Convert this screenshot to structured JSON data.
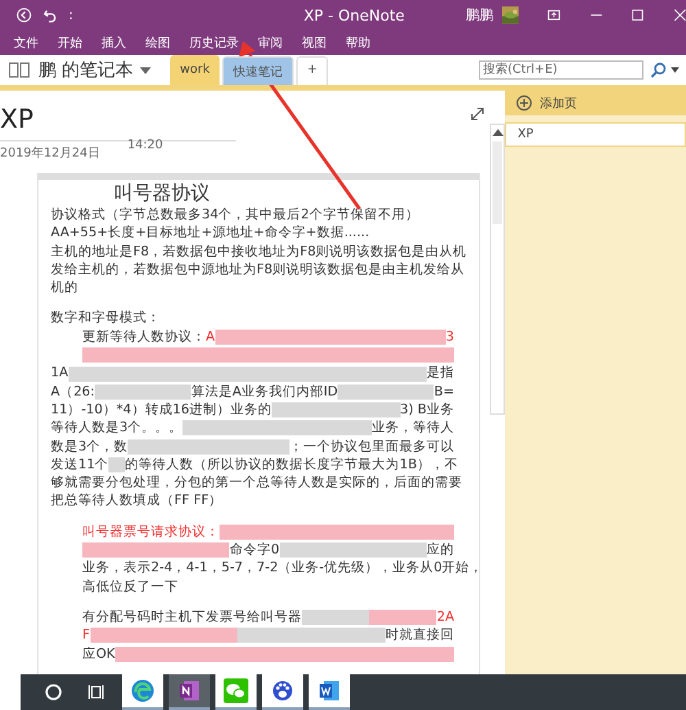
{
  "window": {
    "title": "XP - OneNote",
    "quick_access": ":",
    "user": "鹏鹏"
  },
  "menu": [
    {
      "label": "文件"
    },
    {
      "label": "开始"
    },
    {
      "label": "插入"
    },
    {
      "label": "绘图"
    },
    {
      "label": "历史记录"
    },
    {
      "label": "审阅"
    },
    {
      "label": "视图"
    },
    {
      "label": "帮助"
    }
  ],
  "notebook": {
    "name": "鹏 的笔记本"
  },
  "sections": [
    {
      "label": "work",
      "selected": true,
      "color": "#f3d374"
    },
    {
      "label": "快速笔记",
      "selected": false,
      "color": "#9fc4e8"
    },
    {
      "label": "+",
      "selected": false,
      "color": "#ffffff"
    }
  ],
  "search": {
    "placeholder": "搜索(Ctrl+E)"
  },
  "page": {
    "title": "XP",
    "date": "2019年12月24日",
    "time": "14:20"
  },
  "note": {
    "heading": "叫号器协议",
    "lines": [
      {
        "kind": "line",
        "indent": false,
        "segments": [
          {
            "kind": "text",
            "text": "协议格式（字节总数最多34个，其中最后2个字节保留不用）"
          }
        ]
      },
      {
        "kind": "line",
        "indent": false,
        "segments": [
          {
            "kind": "text",
            "text": "AA+55+长度+目标地址+源地址+命令字+数据......"
          }
        ]
      },
      {
        "kind": "line",
        "indent": false,
        "segments": [
          {
            "kind": "text",
            "text": "主机的地址是F8，若数据包中接收地址为F8则说明该数据包是由从机"
          }
        ]
      },
      {
        "kind": "line",
        "indent": false,
        "segments": [
          {
            "kind": "text",
            "text": "发给主机的，若数据包中源地址为F8则说明该数据包是由主机发给从"
          }
        ]
      },
      {
        "kind": "line",
        "indent": false,
        "segments": [
          {
            "kind": "text",
            "text": "机的"
          }
        ]
      },
      {
        "kind": "blank"
      },
      {
        "kind": "line",
        "indent": false,
        "segments": [
          {
            "kind": "text",
            "text": "数字和字母模式："
          }
        ]
      },
      {
        "kind": "line",
        "indent": true,
        "segments": [
          {
            "kind": "text",
            "text": "更新等待人数协议："
          },
          {
            "kind": "red",
            "text": "A"
          },
          {
            "kind": "blur_red"
          },
          {
            "kind": "red",
            "text": "3"
          }
        ]
      },
      {
        "kind": "line",
        "indent": true,
        "segments": [
          {
            "kind": "blur_red"
          }
        ]
      },
      {
        "kind": "line",
        "indent": false,
        "segments": [
          {
            "kind": "text",
            "text": "1A"
          },
          {
            "kind": "blur"
          },
          {
            "kind": "text",
            "text": "是指"
          }
        ]
      },
      {
        "kind": "line",
        "indent": false,
        "segments": [
          {
            "kind": "text",
            "text": "A（26:"
          },
          {
            "kind": "blur"
          },
          {
            "kind": "text",
            "text": "算法是A业务我们内部ID"
          },
          {
            "kind": "blur"
          },
          {
            "kind": "text",
            "text": "B="
          }
        ]
      },
      {
        "kind": "line",
        "indent": false,
        "segments": [
          {
            "kind": "text",
            "text": "11）-10）*4）转成16进制）业务的"
          },
          {
            "kind": "blur"
          },
          {
            "kind": "text",
            "text": "3) B业务"
          }
        ]
      },
      {
        "kind": "line",
        "indent": false,
        "segments": [
          {
            "kind": "text",
            "text": "等待人数是3个。。。"
          },
          {
            "kind": "blur"
          },
          {
            "kind": "text",
            "text": "业务，等待人"
          }
        ]
      },
      {
        "kind": "line",
        "indent": false,
        "segments": [
          {
            "kind": "text",
            "text": "数是3个，数"
          },
          {
            "kind": "blur"
          },
          {
            "kind": "text",
            "text": "；一个协议包里面最多可以"
          }
        ]
      },
      {
        "kind": "line",
        "indent": false,
        "segments": [
          {
            "kind": "text",
            "text": "发送11个"
          },
          {
            "kind": "blur"
          },
          {
            "kind": "text",
            "text": "的等待人数（所以协议的数据长度字节最大为1B），不"
          }
        ]
      },
      {
        "kind": "line",
        "indent": false,
        "segments": [
          {
            "kind": "text",
            "text": "够就需要分包处理，分包的第一个总等待人数是实际的，后面的需要"
          }
        ]
      },
      {
        "kind": "line",
        "indent": false,
        "segments": [
          {
            "kind": "text",
            "text": "把总等待人数填成（FF FF）"
          }
        ]
      },
      {
        "kind": "blank"
      },
      {
        "kind": "line",
        "indent": true,
        "segments": [
          {
            "kind": "red",
            "text": "叫号器票号请求协议："
          },
          {
            "kind": "blur_red"
          }
        ]
      },
      {
        "kind": "line",
        "indent": true,
        "segments": [
          {
            "kind": "blur_red"
          },
          {
            "kind": "text",
            "text": "命令字0"
          },
          {
            "kind": "blur"
          },
          {
            "kind": "text",
            "text": "应的"
          }
        ]
      },
      {
        "kind": "line",
        "indent": true,
        "segments": [
          {
            "kind": "text",
            "text": "业务，表示2-4，4-1，5-7，7-2（业务-优先级），业务从0开始，"
          }
        ]
      },
      {
        "kind": "line",
        "indent": true,
        "segments": [
          {
            "kind": "text",
            "text": "高低位反了一下"
          }
        ]
      },
      {
        "kind": "blank"
      },
      {
        "kind": "line",
        "indent": true,
        "segments": [
          {
            "kind": "text",
            "text": "有分配号码时主机下发票号给叫号器"
          },
          {
            "kind": "blur"
          },
          {
            "kind": "blur_red"
          },
          {
            "kind": "red",
            "text": "2A"
          }
        ]
      },
      {
        "kind": "line",
        "indent": true,
        "segments": [
          {
            "kind": "red",
            "text": "F"
          },
          {
            "kind": "blur_red"
          },
          {
            "kind": "blur"
          },
          {
            "kind": "text",
            "text": "时就直接回"
          }
        ]
      },
      {
        "kind": "line",
        "indent": true,
        "segments": [
          {
            "kind": "text",
            "text": "应OK"
          },
          {
            "kind": "blur_red"
          }
        ]
      }
    ]
  },
  "pages_pane": {
    "add_label": "添加页",
    "pages": [
      {
        "label": "XP",
        "selected": true
      }
    ]
  },
  "taskbar": [
    {
      "kind": "start"
    },
    {
      "kind": "taskview"
    },
    {
      "kind": "edge",
      "selected": false
    },
    {
      "kind": "onenote",
      "selected": true
    },
    {
      "kind": "wechat",
      "selected": false
    },
    {
      "kind": "baidu",
      "selected": false
    },
    {
      "kind": "word",
      "selected": false
    }
  ]
}
